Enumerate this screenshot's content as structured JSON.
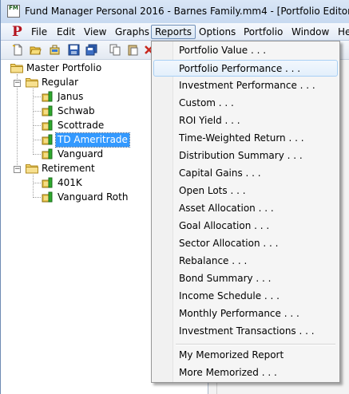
{
  "window": {
    "title": "Fund Manager Personal 2016 - Barnes Family.mm4 - [Portfolio Editor]",
    "app_icon_letters": "FM"
  },
  "menubar": {
    "items": [
      {
        "label": "File"
      },
      {
        "label": "Edit"
      },
      {
        "label": "View"
      },
      {
        "label": "Graphs"
      },
      {
        "label": "Reports"
      },
      {
        "label": "Options"
      },
      {
        "label": "Portfolio"
      },
      {
        "label": "Window"
      },
      {
        "label": "He"
      }
    ],
    "active": "Reports"
  },
  "tree": {
    "root": "Master Portfolio",
    "groups": [
      {
        "name": "Regular",
        "accounts": [
          "Janus",
          "Schwab",
          "Scottrade",
          "TD Ameritrade",
          "Vanguard"
        ]
      },
      {
        "name": "Retirement",
        "accounts": [
          "401K",
          "Vanguard Roth"
        ]
      }
    ],
    "selected": "TD Ameritrade"
  },
  "reports_menu": {
    "items": [
      "Portfolio Value . . .",
      "Portfolio Performance . . .",
      "Investment Performance . . .",
      "Custom . . .",
      "ROI Yield . . .",
      "Time-Weighted Return . . .",
      "Distribution Summary . . .",
      "Capital Gains . . .",
      "Open Lots . . .",
      "Asset Allocation . . .",
      "Goal Allocation . . .",
      "Sector Allocation . . .",
      "Rebalance . . .",
      "Bond Summary . . .",
      "Income Schedule . . .",
      "Monthly Performance . . .",
      "Investment Transactions . . ."
    ],
    "memorized": [
      "My Memorized Report",
      "More Memorized . . ."
    ],
    "hovered": "Portfolio Performance . . ."
  },
  "colors": {
    "selection": "#3399ff",
    "logo_red": "#b4141e",
    "account_green": "#2ea82e",
    "folder_yellow": "#e8c24a"
  }
}
